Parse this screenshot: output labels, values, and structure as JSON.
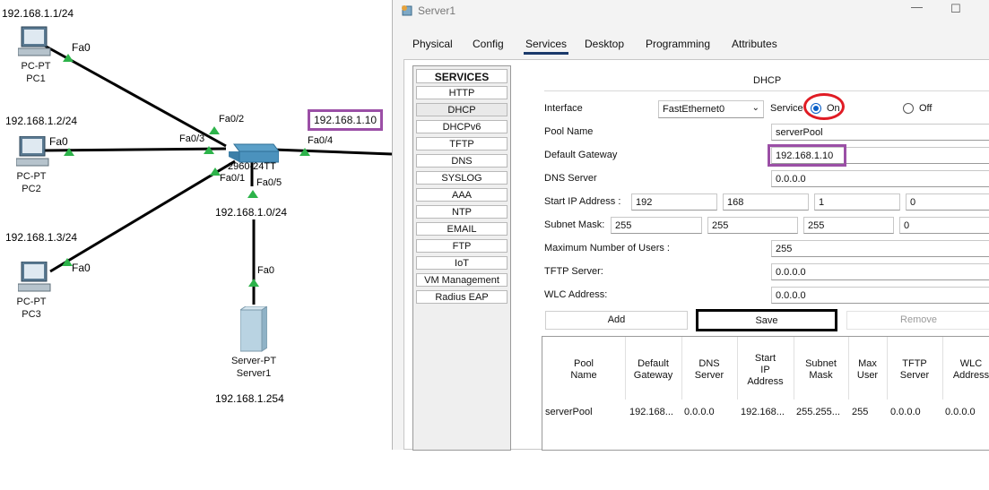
{
  "topology": {
    "pc1": {
      "ip": "192.168.1.1/24",
      "port": "Fa0",
      "type": "PC-PT",
      "name": "PC1"
    },
    "pc2": {
      "ip": "192.168.1.2/24",
      "port": "Fa0",
      "type": "PC-PT",
      "name": "PC2"
    },
    "pc3": {
      "ip": "192.168.1.3/24",
      "port": "Fa0",
      "type": "PC-PT",
      "name": "PC3"
    },
    "switch": {
      "model": "2960-24TT",
      "ports": {
        "p1": "Fa0/1",
        "p2": "Fa0/2",
        "p3": "Fa0/3",
        "p4": "Fa0/4",
        "p5": "Fa0/5"
      }
    },
    "network": "192.168.1.0/24",
    "gateway_label": "192.168.1.10",
    "server": {
      "port": "Fa0",
      "type": "Server-PT",
      "name": "Server1",
      "ip": "192.168.1.254"
    }
  },
  "window": {
    "title": "Server1",
    "tabs": [
      "Physical",
      "Config",
      "Services",
      "Desktop",
      "Programming",
      "Attributes"
    ],
    "active_tab": "Services"
  },
  "services": {
    "header": "SERVICES",
    "items": [
      "HTTP",
      "DHCP",
      "DHCPv6",
      "TFTP",
      "DNS",
      "SYSLOG",
      "AAA",
      "NTP",
      "EMAIL",
      "FTP",
      "IoT",
      "VM Management",
      "Radius EAP"
    ],
    "selected": "DHCP"
  },
  "dhcp": {
    "title": "DHCP",
    "interface_label": "Interface",
    "interface_value": "FastEthernet0",
    "service_label": "Service",
    "on_label": "On",
    "off_label": "Off",
    "service_state": "On",
    "pool_name_label": "Pool Name",
    "pool_name": "serverPool",
    "gateway_label": "Default Gateway",
    "gateway": "192.168.1.10",
    "dns_label": "DNS Server",
    "dns": "0.0.0.0",
    "start_ip_label": "Start IP Address :",
    "start_ip": [
      "192",
      "168",
      "1",
      "0"
    ],
    "mask_label": "Subnet Mask:",
    "mask": [
      "255",
      "255",
      "255",
      "0"
    ],
    "max_users_label": "Maximum Number of Users :",
    "max_users": "255",
    "tftp_label": "TFTP Server:",
    "tftp": "0.0.0.0",
    "wlc_label": "WLC Address:",
    "wlc": "0.0.0.0",
    "add_label": "Add",
    "save_label": "Save",
    "remove_label": "Remove",
    "table": {
      "headers": [
        "Pool\nName",
        "Default\nGateway",
        "DNS\nServer",
        "Start\nIP\nAddress",
        "Subnet\nMask",
        "Max\nUser",
        "TFTP\nServer",
        "WLC\nAddress"
      ],
      "rows": [
        [
          "serverPool",
          "192.168...",
          "0.0.0.0",
          "192.168...",
          "255.255...",
          "255",
          "0.0.0.0",
          "0.0.0.0"
        ]
      ]
    }
  },
  "colors": {
    "highlight_purple": "#9b4fa6",
    "annotation_red": "#e01b24",
    "radio_blue": "#0a5fc7",
    "tab_underline": "#1b3a6b",
    "link_green": "#2db34a"
  }
}
